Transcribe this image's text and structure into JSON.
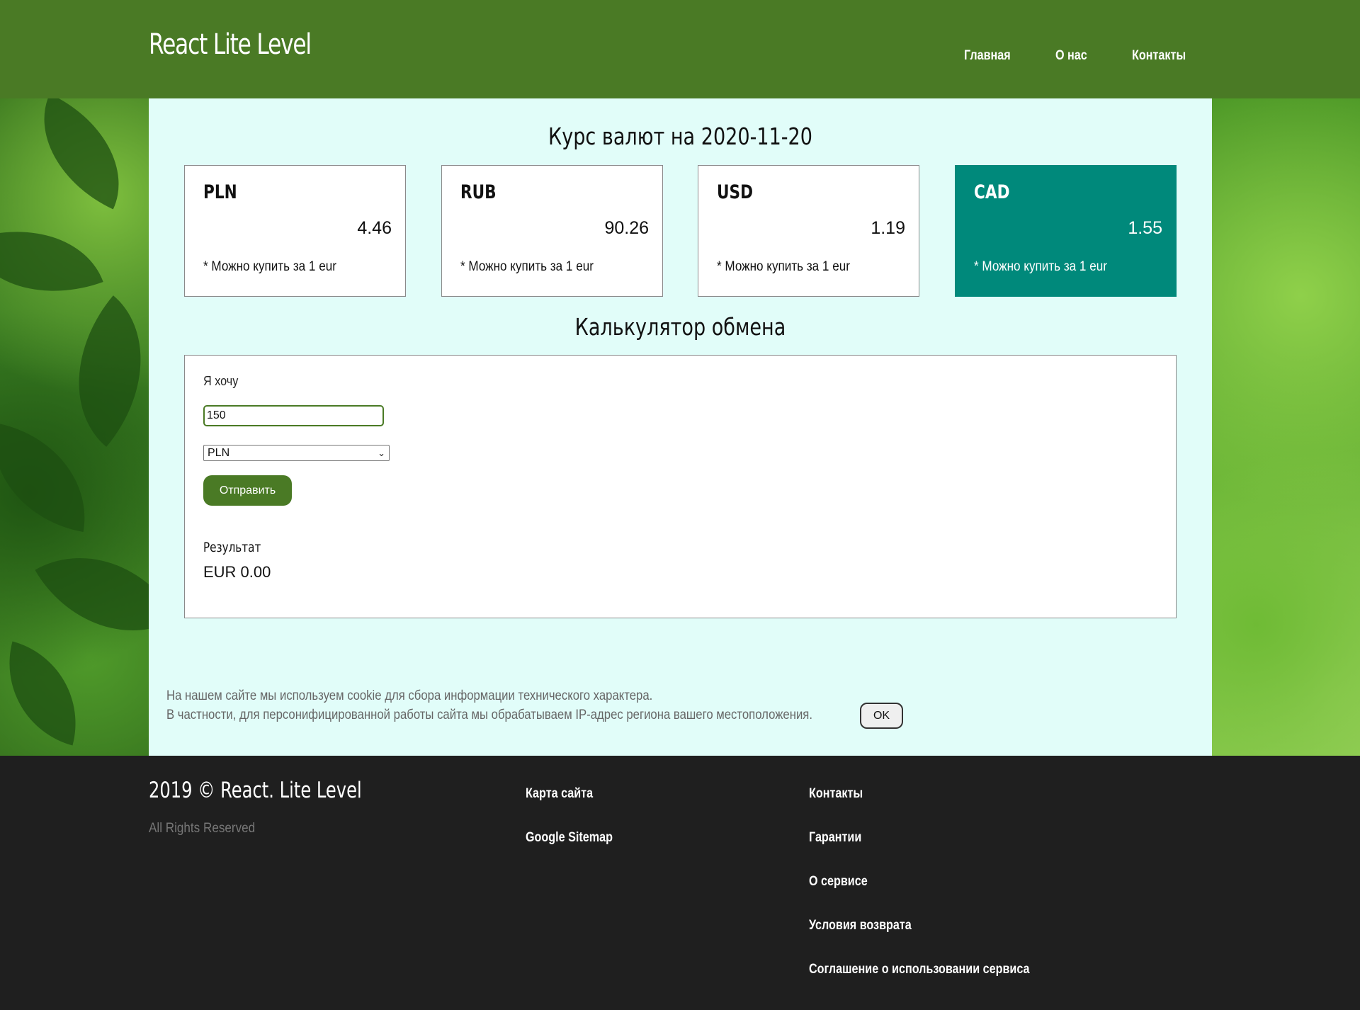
{
  "header": {
    "logo": "React Lite Level",
    "nav": [
      "Главная",
      "О нас",
      "Контакты"
    ]
  },
  "rates": {
    "title": "Курс валют на 2020-11-20",
    "cards": [
      {
        "code": "PLN",
        "value": "4.46",
        "note": "* Можно купить за 1 eur",
        "active": false
      },
      {
        "code": "RUB",
        "value": "90.26",
        "note": "* Можно купить за 1 eur",
        "active": false
      },
      {
        "code": "USD",
        "value": "1.19",
        "note": "* Можно купить за 1 eur",
        "active": false
      },
      {
        "code": "CAD",
        "value": "1.55",
        "note": "* Можно купить за 1 eur",
        "active": true
      }
    ]
  },
  "calculator": {
    "title": "Калькулятор обмена",
    "want_label": "Я хочу",
    "amount_value": "150",
    "currency_selected": "PLN",
    "send_label": "Отправить",
    "result_label": "Результат",
    "result_value": "EUR 0.00"
  },
  "cookie": {
    "line1": "На нашем сайте мы используем cookie для сбора информации технического характера.",
    "line2": "В частности, для персонифицированной работы сайта мы обрабатываем IP-адрес региона вашего местоположения.",
    "ok_label": "OK"
  },
  "footer": {
    "copyright": "2019 © React. Lite Level",
    "rights": "All Rights Reserved",
    "col1": [
      "Карта сайта",
      "Google Sitemap"
    ],
    "col2": [
      "Контакты",
      "Гарантии",
      "О сервисе",
      "Условия возврата",
      "Соглашение о использовании сервиса"
    ]
  },
  "colors": {
    "header_bg": "#4a7a25",
    "main_bg": "#e1fdf9",
    "active_card": "#00897b",
    "footer_bg": "#1f1f1f"
  }
}
